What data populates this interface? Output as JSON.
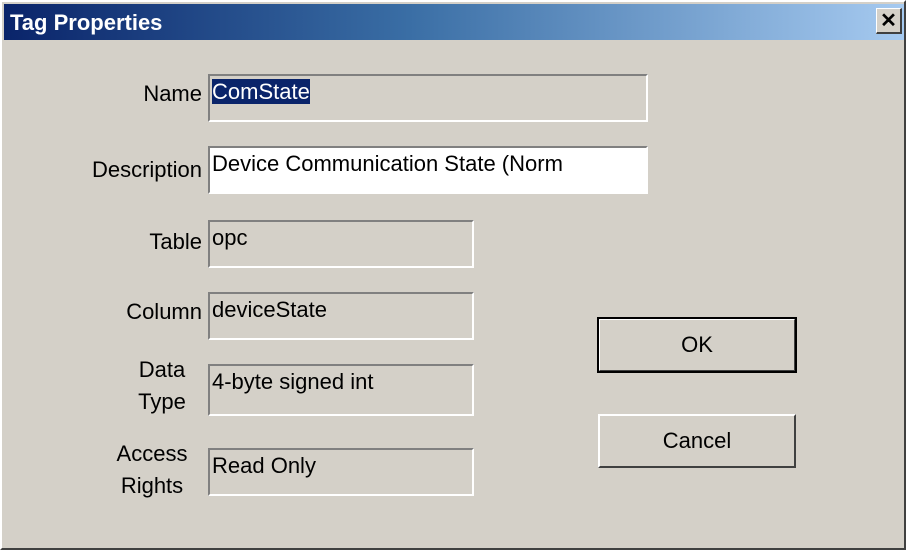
{
  "window": {
    "title": "Tag Properties",
    "close_label": "✕"
  },
  "fields": {
    "name": {
      "label": "Name",
      "value": "ComState"
    },
    "description": {
      "label": "Description",
      "value": "Device Communication State (Norm"
    },
    "table": {
      "label": "Table",
      "value": "opc"
    },
    "column": {
      "label": "Column",
      "value": "deviceState"
    },
    "data_type": {
      "label_line1": "Data",
      "label_line2": "Type",
      "value": "4-byte signed int"
    },
    "access_rights": {
      "label_line1": "Access",
      "label_line2": "Rights",
      "value": "Read Only"
    }
  },
  "buttons": {
    "ok": "OK",
    "cancel": "Cancel"
  }
}
